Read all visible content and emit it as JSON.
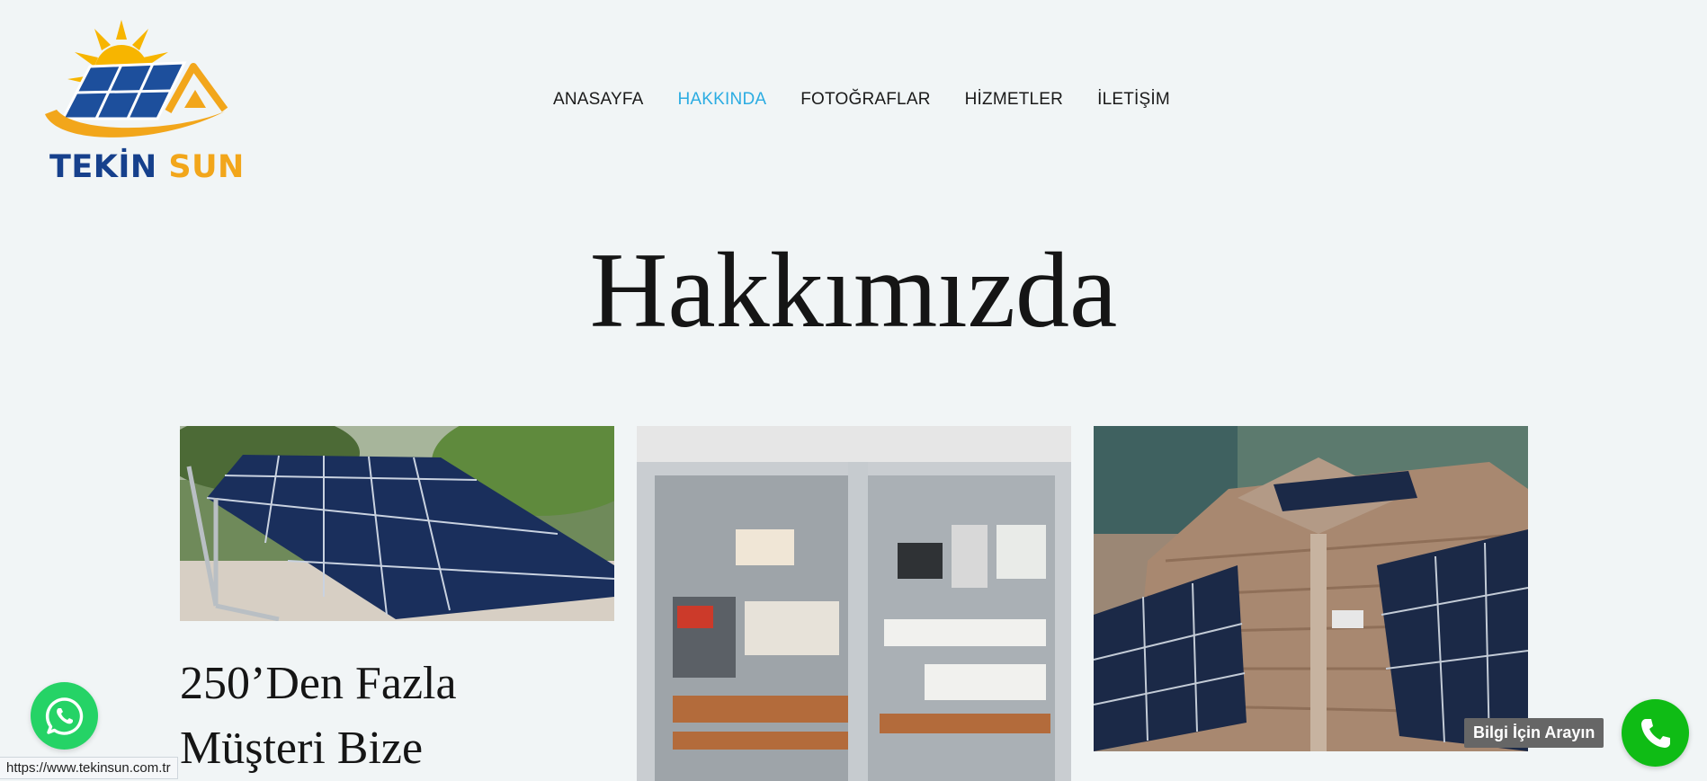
{
  "brand": {
    "name_part1": "TEKİN",
    "name_part2": "SUN"
  },
  "nav": {
    "items": [
      {
        "label": "ANASAYFA"
      },
      {
        "label": "HAKKINDA"
      },
      {
        "label": "FOTOĞRAFLAR"
      },
      {
        "label": "HİZMETLER"
      },
      {
        "label": "İLETİŞİM"
      }
    ],
    "active_index": 1
  },
  "page": {
    "title": "Hakkımızda",
    "headline_line1": "250’Den Fazla",
    "headline_line2": "Müşteri Bize"
  },
  "images": [
    {
      "name": "solar-panels-ground-mount-photo"
    },
    {
      "name": "electrical-panel-photo"
    },
    {
      "name": "rooftop-solar-panels-photo"
    }
  ],
  "floating": {
    "call_label": "Bilgi İçin Arayın",
    "call_icon": "phone-icon",
    "whatsapp_icon": "whatsapp-icon"
  },
  "status_bar": {
    "url": "https://www.tekinsun.com.tr"
  },
  "colors": {
    "background": "#f1f5f6",
    "nav_active": "#2bace2",
    "brand_blue": "#16408c",
    "brand_orange": "#f2a61b",
    "whatsapp_green": "#25d366",
    "call_green": "#0fbc15"
  }
}
